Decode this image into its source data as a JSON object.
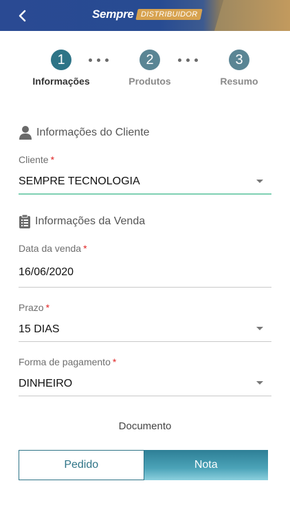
{
  "header": {
    "logo_main": "Sempre",
    "logo_badge": "DISTRIBUIDOR",
    "back_icon": "chevron-left-icon"
  },
  "stepper": {
    "steps": [
      {
        "number": "1",
        "label": "Informações",
        "active": true
      },
      {
        "number": "2",
        "label": "Produtos",
        "active": false
      },
      {
        "number": "3",
        "label": "Resumo",
        "active": false
      }
    ]
  },
  "client_section": {
    "title": "Informações do Cliente",
    "icon": "user-icon",
    "client_label": "Cliente",
    "client_value": "SEMPRE TECNOLOGIA"
  },
  "sale_section": {
    "title": "Informações da Venda",
    "icon": "clipboard-icon",
    "date_label": "Data da venda",
    "date_value": "16/06/2020",
    "term_label": "Prazo",
    "term_value": "15 DIAS",
    "payment_label": "Forma de pagamento",
    "payment_value": "DINHEIRO"
  },
  "required_marker": "*",
  "document": {
    "title": "Documento",
    "option_order": "Pedido",
    "option_invoice": "Nota",
    "selected": "Nota"
  },
  "colors": {
    "accent": "#2e7487",
    "required": "#e02424",
    "focus_line": "#7fd0b3"
  }
}
